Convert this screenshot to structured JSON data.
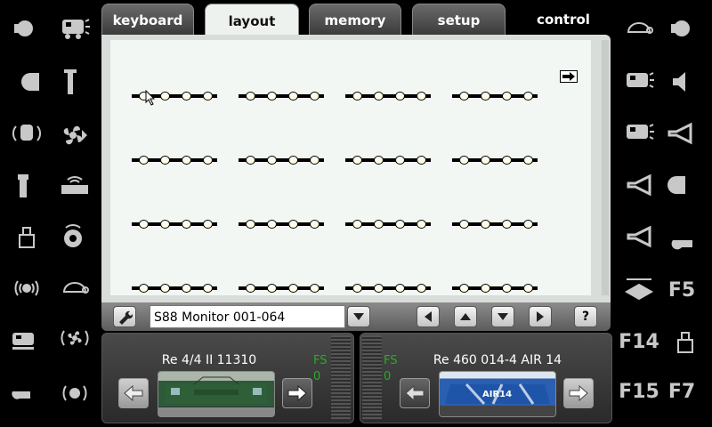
{
  "tabs": [
    {
      "label": "keyboard"
    },
    {
      "label": "layout"
    },
    {
      "label": "memory"
    },
    {
      "label": "setup"
    },
    {
      "label": "control"
    }
  ],
  "active_tab": "layout",
  "layout_panel": {
    "modules_per_row": 4,
    "rows": 4,
    "leds_per_module": 4
  },
  "toolbar": {
    "selected_module": "S88 Monitor 001-064",
    "help_label": "?"
  },
  "left_functions": [
    "light-icon",
    "loco-sound-icon",
    "headlight-icon",
    "pantograph-icon",
    "radio-icon",
    "fan-icon",
    "coupler-icon",
    "cab-radio-icon",
    "weight-icon",
    "compressor-icon",
    "sound-icon",
    "turtle-icon",
    "train-announce-icon",
    "fan-sound-icon",
    "whistle-icon",
    "announce-sound-icon"
  ],
  "right_functions": {
    "icons": [
      "turtle-icon",
      "light-icon",
      "loco-sound-icon",
      "speaker-icon",
      "train-sound-icon",
      "horn-icon",
      "horn-icon",
      "highbeam-icon",
      "horn-icon",
      "whistle-icon",
      "turntable-icon"
    ],
    "f5": "F5",
    "f14": "F14",
    "f15": "F15",
    "f7": "F7"
  },
  "loco_left": {
    "name": "Re 4/4 II 11310",
    "fs_label": "FS",
    "fs_value": "0"
  },
  "loco_right": {
    "name": "Re 460 014-4 AIR 14",
    "fs_label": "FS",
    "fs_value": "0",
    "livery_text": "AIR14"
  },
  "colors": {
    "fs_green": "#22b022",
    "panel_bg": "#f3f7f3"
  }
}
